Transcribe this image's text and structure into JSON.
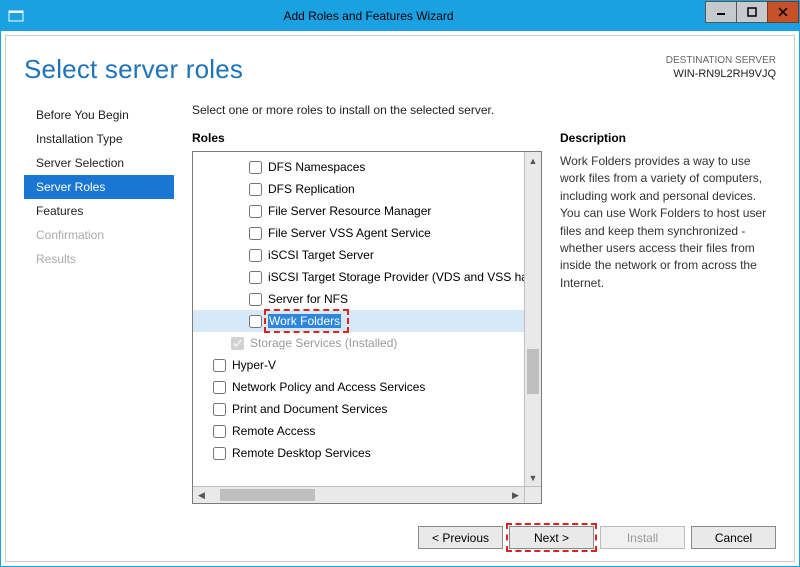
{
  "window": {
    "title": "Add Roles and Features Wizard"
  },
  "header": {
    "page_title": "Select server roles",
    "destination_label": "DESTINATION SERVER",
    "destination_name": "WIN-RN9L2RH9VJQ"
  },
  "sidebar": {
    "steps": [
      {
        "label": "Before You Begin",
        "state": "normal"
      },
      {
        "label": "Installation Type",
        "state": "normal"
      },
      {
        "label": "Server Selection",
        "state": "normal"
      },
      {
        "label": "Server Roles",
        "state": "active"
      },
      {
        "label": "Features",
        "state": "normal"
      },
      {
        "label": "Confirmation",
        "state": "disabled"
      },
      {
        "label": "Results",
        "state": "disabled"
      }
    ]
  },
  "main": {
    "instruction": "Select one or more roles to install on the selected server.",
    "roles_heading": "Roles",
    "description_heading": "Description",
    "description_text": "Work Folders provides a way to use work files from a variety of computers, including work and personal devices. You can use Work Folders to host user files and keep them synchronized - whether users access their files from inside the network or from across the Internet.",
    "roles": [
      {
        "label": "DFS Namespaces",
        "indent": 2,
        "checked": false,
        "disabled": false,
        "highlighted": false
      },
      {
        "label": "DFS Replication",
        "indent": 2,
        "checked": false,
        "disabled": false,
        "highlighted": false
      },
      {
        "label": "File Server Resource Manager",
        "indent": 2,
        "checked": false,
        "disabled": false,
        "highlighted": false
      },
      {
        "label": "File Server VSS Agent Service",
        "indent": 2,
        "checked": false,
        "disabled": false,
        "highlighted": false
      },
      {
        "label": "iSCSI Target Server",
        "indent": 2,
        "checked": false,
        "disabled": false,
        "highlighted": false
      },
      {
        "label": "iSCSI Target Storage Provider (VDS and VSS hardware providers)",
        "indent": 2,
        "checked": false,
        "disabled": false,
        "highlighted": false
      },
      {
        "label": "Server for NFS",
        "indent": 2,
        "checked": false,
        "disabled": false,
        "highlighted": false
      },
      {
        "label": "Work Folders",
        "indent": 2,
        "checked": false,
        "disabled": false,
        "highlighted": true
      },
      {
        "label": "Storage Services (Installed)",
        "indent": 1,
        "checked": true,
        "disabled": true,
        "highlighted": false
      },
      {
        "label": "Hyper-V",
        "indent": 0,
        "checked": false,
        "disabled": false,
        "highlighted": false
      },
      {
        "label": "Network Policy and Access Services",
        "indent": 0,
        "checked": false,
        "disabled": false,
        "highlighted": false
      },
      {
        "label": "Print and Document Services",
        "indent": 0,
        "checked": false,
        "disabled": false,
        "highlighted": false
      },
      {
        "label": "Remote Access",
        "indent": 0,
        "checked": false,
        "disabled": false,
        "highlighted": false
      },
      {
        "label": "Remote Desktop Services",
        "indent": 0,
        "checked": false,
        "disabled": false,
        "highlighted": false
      }
    ]
  },
  "buttons": {
    "previous": "< Previous",
    "next": "Next >",
    "install": "Install",
    "cancel": "Cancel"
  }
}
